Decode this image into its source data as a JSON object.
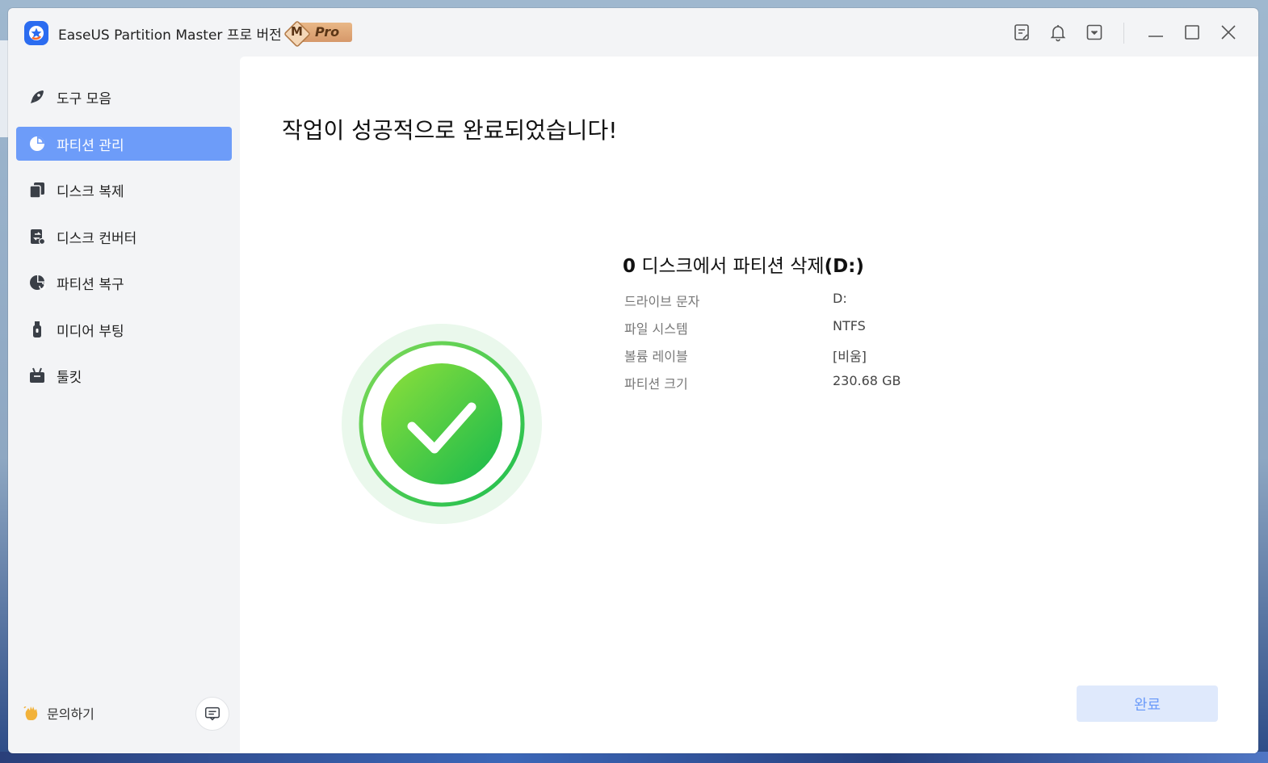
{
  "app": {
    "title": "EaseUS Partition Master 프로 버전",
    "badge_letter": "M",
    "badge_label": "Pro"
  },
  "sidebar": {
    "items": [
      {
        "label": "도구 모음",
        "icon": "rocket-icon",
        "active": false
      },
      {
        "label": "파티션 관리",
        "icon": "pie-chart-icon",
        "active": true
      },
      {
        "label": "디스크 복제",
        "icon": "copy-icon",
        "active": false
      },
      {
        "label": "디스크 컨버터",
        "icon": "convert-icon",
        "active": false
      },
      {
        "label": "파티션 복구",
        "icon": "recovery-icon",
        "active": false
      },
      {
        "label": "미디어 부팅",
        "icon": "usb-icon",
        "active": false
      },
      {
        "label": "툴킷",
        "icon": "toolkit-icon",
        "active": false
      }
    ],
    "contact_label": "문의하기"
  },
  "main": {
    "heading": "작업이 성공적으로 완료되었습니다!",
    "operation_disk": "0",
    "operation_text": " 디스크에서 파티션 삭제",
    "operation_drive": "(D:)",
    "details": [
      {
        "key": "드라이브 문자",
        "value": "D:"
      },
      {
        "key": "파일 시스템",
        "value": "NTFS"
      },
      {
        "key": "볼륨 레이블",
        "value": "[비움]"
      },
      {
        "key": "파티션 크기",
        "value": "230.68 GB"
      }
    ],
    "done_label": "완료"
  },
  "colors": {
    "accent": "#6d9cf9",
    "success": "#2cc84d"
  }
}
